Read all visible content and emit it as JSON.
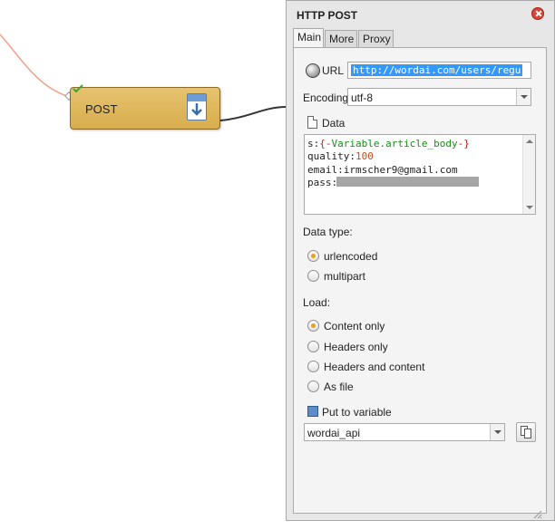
{
  "node": {
    "label": "POST"
  },
  "panel": {
    "title": "HTTP POST",
    "tabs": [
      {
        "label": "Main",
        "active": true
      },
      {
        "label": "More",
        "active": false
      },
      {
        "label": "Proxy",
        "active": false
      }
    ],
    "url": {
      "label": "URL",
      "value": "http://wordai.com/users/regu"
    },
    "encoding": {
      "label": "Encoding",
      "value": "utf-8"
    },
    "data": {
      "label": "Data",
      "lines": [
        {
          "key": "s:",
          "open": "{-",
          "var": "Variable.article_body",
          "close": "-}"
        },
        {
          "key": "quality:",
          "value": "100"
        },
        {
          "key": "email:",
          "value": "irmscher9@gmail.com"
        },
        {
          "key": "pass:",
          "value": ""
        }
      ]
    },
    "data_type": {
      "label": "Data type:",
      "options": [
        {
          "label": "urlencoded",
          "selected": true
        },
        {
          "label": "multipart",
          "selected": false
        }
      ]
    },
    "load": {
      "label": "Load:",
      "options": [
        {
          "label": "Content only",
          "selected": true
        },
        {
          "label": "Headers only",
          "selected": false
        },
        {
          "label": "Headers and content",
          "selected": false
        },
        {
          "label": "As file",
          "selected": false
        }
      ]
    },
    "put_to_variable": {
      "label": "Put to variable",
      "value": "wordai_api"
    }
  },
  "icons": {
    "close": "close-icon",
    "url": "globe-icon",
    "data": "document-icon",
    "variable": "variable-icon",
    "copy": "copy-icon",
    "node": "download-icon",
    "status": "check-icon"
  },
  "colors": {
    "node_fill": "#ddb558",
    "selection": "#3399ff",
    "radio_selected": "#e5a11f",
    "close_button": "#d9453b",
    "variable_text": "#1c8a1c",
    "variable_brace": "#c81d1d"
  }
}
